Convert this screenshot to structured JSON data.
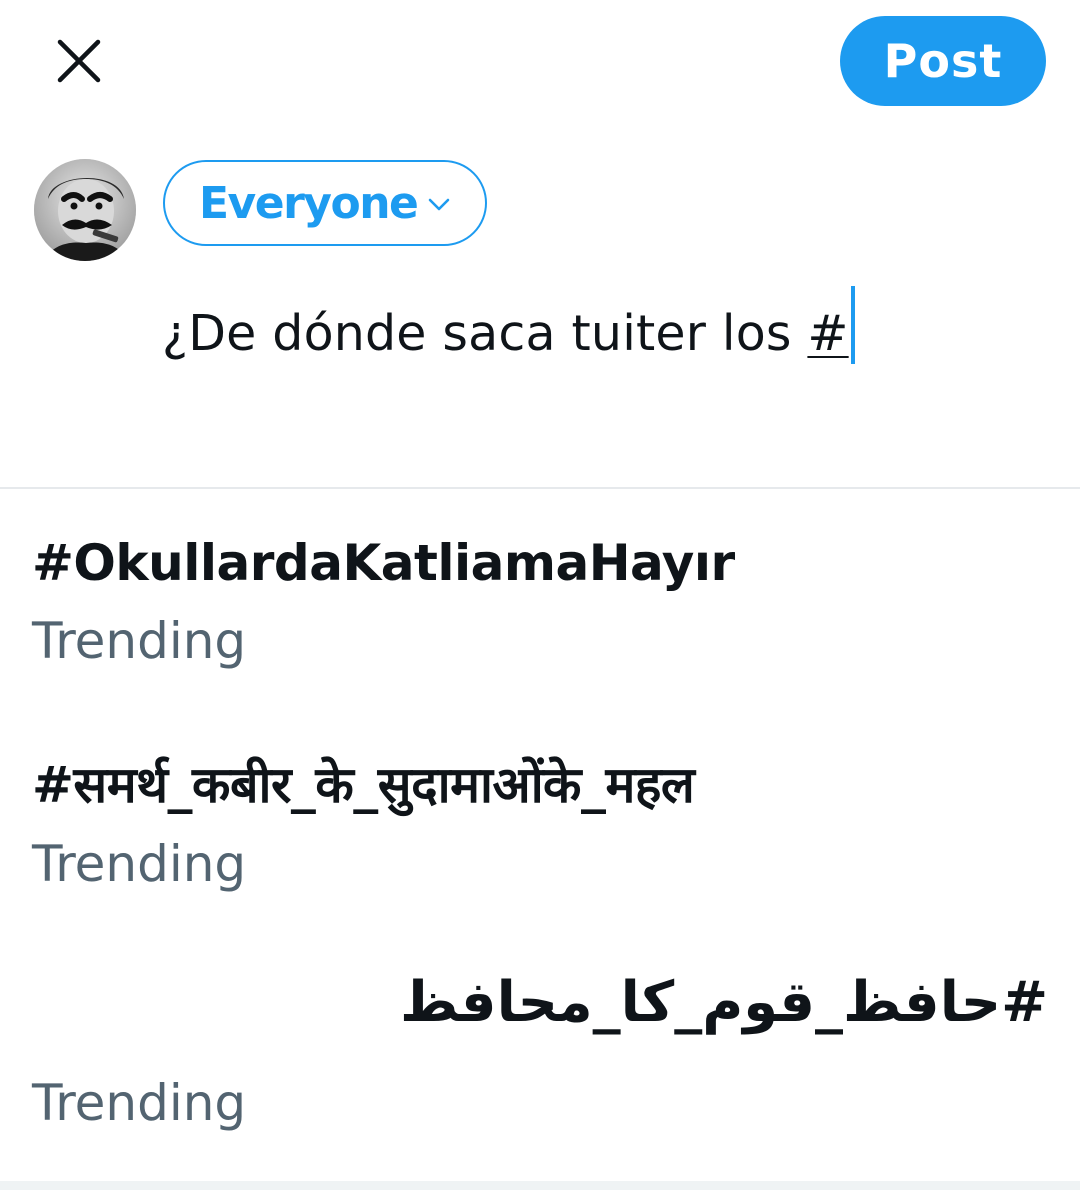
{
  "header": {
    "close_icon": "close-icon",
    "post_label": "Post"
  },
  "composer": {
    "avatar_icon": "user-avatar",
    "audience_label": "Everyone",
    "audience_icon": "chevron-down-icon",
    "text_before": "¿De dónde saca tuiter los ",
    "text_hashtag": "#"
  },
  "suggestions": [
    {
      "tag": "#OkullardaKatliamaHayır",
      "subtitle": "Trending"
    },
    {
      "tag": "#समर्थ_कबीर_के_सुदामाओंके_महल",
      "subtitle": "Trending"
    },
    {
      "tag": "#حافظ_قوم_کا_محافظ",
      "subtitle": "Trending"
    }
  ],
  "colors": {
    "accent": "#1d9bf0",
    "text_primary": "#0f1419",
    "text_secondary": "#536471",
    "divider": "#e6e9ec"
  }
}
